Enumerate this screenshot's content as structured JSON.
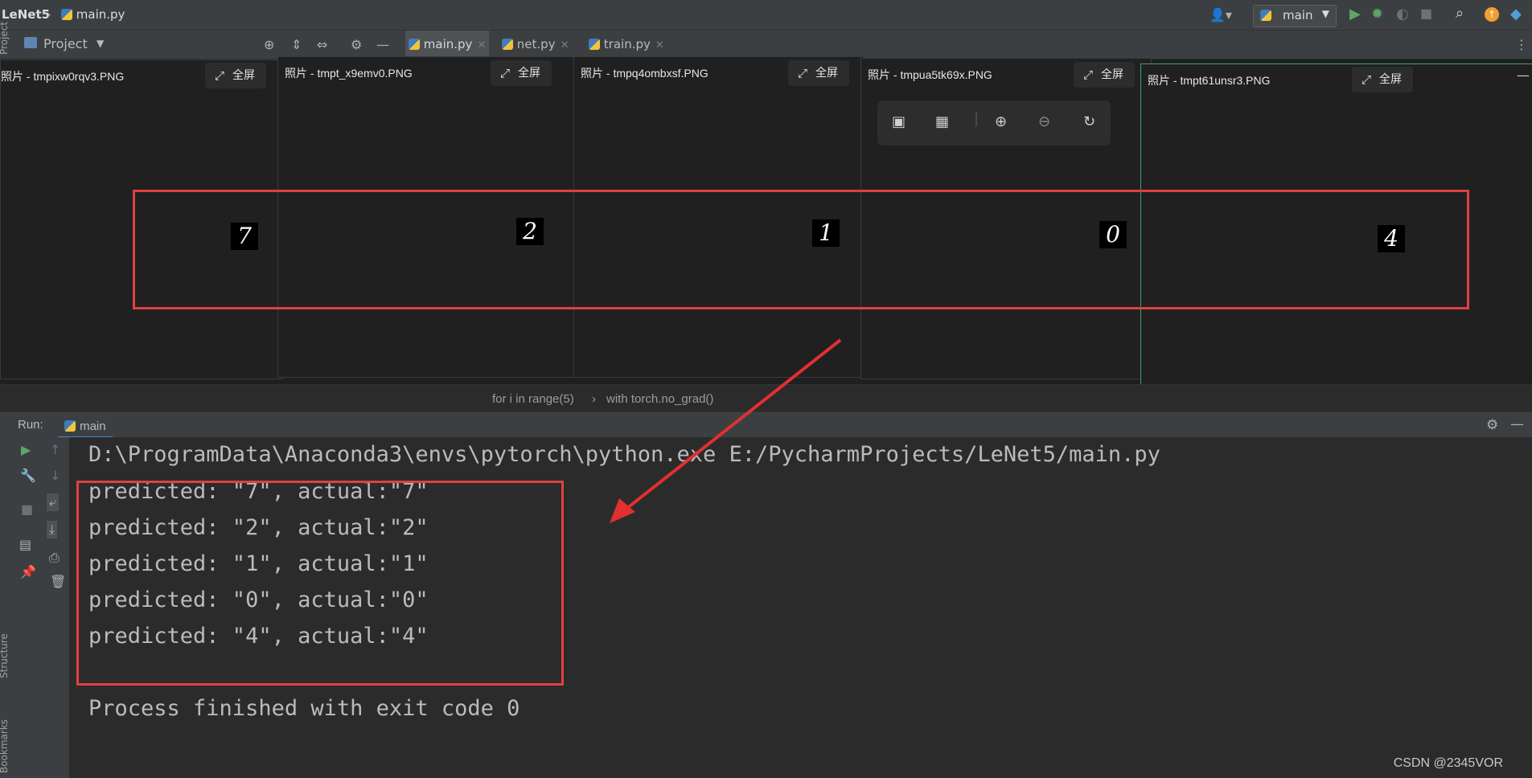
{
  "window": {
    "project": "LeNet5",
    "file": "main.py",
    "run_config": "main"
  },
  "toolbar": {
    "project_label": "Project"
  },
  "tabs": [
    {
      "label": "main.py"
    },
    {
      "label": "net.py"
    },
    {
      "label": "train.py"
    }
  ],
  "photos": [
    {
      "title": "照片 - tmpixw0rqv3.PNG",
      "fullscreen": "全屏",
      "digit": "7"
    },
    {
      "title": "照片 - tmpt_x9emv0.PNG",
      "fullscreen": "全屏",
      "digit": "2"
    },
    {
      "title": "照片 - tmpq4ombxsf.PNG",
      "fullscreen": "全屏",
      "digit": "1"
    },
    {
      "title": "照片 - tmpua5tk69x.PNG",
      "fullscreen": "全屏",
      "digit": "0"
    },
    {
      "title": "照片 - tmpt61unsr3.PNG",
      "fullscreen": "全屏",
      "digit": "4"
    }
  ],
  "editor_breadcrumbs": [
    "for i in range(5)",
    "with torch.no_grad()"
  ],
  "run_panel": {
    "label": "Run:",
    "config": "main"
  },
  "console": {
    "command": "D:\\ProgramData\\Anaconda3\\envs\\pytorch\\python.exe E:/PycharmProjects/LeNet5/main.py",
    "lines": [
      "predicted: \"7\", actual:\"7\"",
      "predicted: \"2\", actual:\"2\"",
      "predicted: \"1\", actual:\"1\"",
      "predicted: \"0\", actual:\"0\"",
      "predicted: \"4\", actual:\"4\""
    ],
    "exit": "Process finished with exit code 0"
  },
  "side_labels": {
    "project": "Project",
    "structure": "Structure",
    "bookmarks": "Bookmarks"
  },
  "watermark": "CSDN @2345VOR",
  "colors": {
    "highlight": "#e04040",
    "active_window_border": "#3fa36a"
  }
}
